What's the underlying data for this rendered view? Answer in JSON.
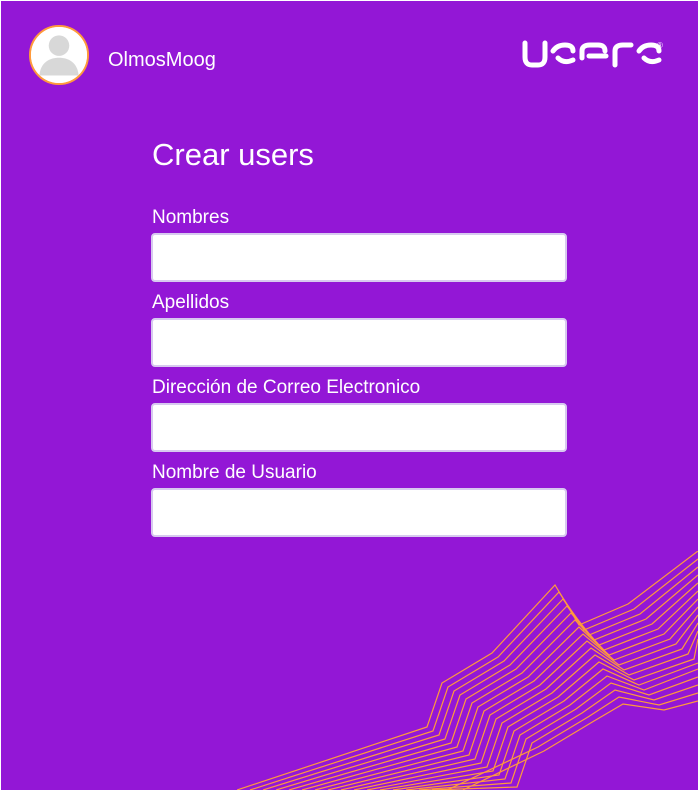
{
  "header": {
    "username": "OlmosMoog",
    "avatar_icon": "user-avatar-icon",
    "brand_name": "users",
    "brand_trademark": "®"
  },
  "form": {
    "title": "Crear users",
    "fields": [
      {
        "label": "Nombres",
        "value": "",
        "placeholder": ""
      },
      {
        "label": "Apellidos",
        "value": "",
        "placeholder": ""
      },
      {
        "label": "Dirección de Correo Electronico",
        "value": "",
        "placeholder": ""
      },
      {
        "label": "Nombre de Usuario",
        "value": "",
        "placeholder": ""
      }
    ]
  },
  "colors": {
    "background": "#9317d6",
    "accent_orange": "#ff9a3c",
    "text": "#ffffff",
    "input_background": "#ffffff",
    "input_border": "#d7c9ef"
  },
  "icons": {
    "avatar": "user-icon",
    "decoration": "orange-line-pattern"
  }
}
